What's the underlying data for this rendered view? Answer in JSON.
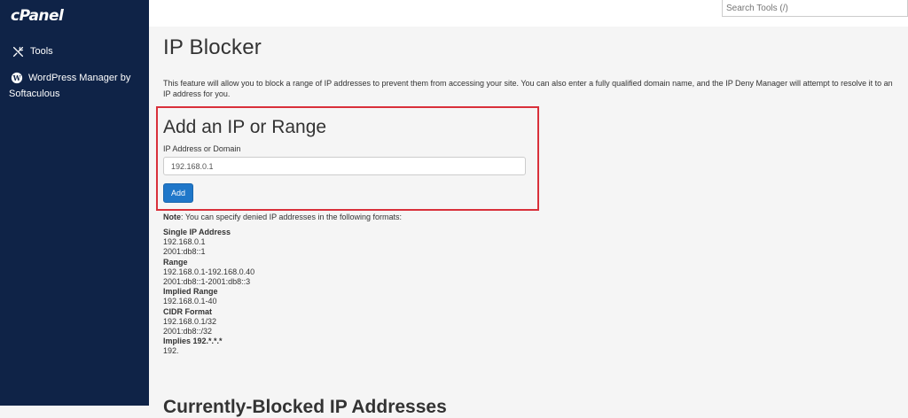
{
  "sidebar": {
    "logo": "cPanel",
    "items": [
      {
        "label": "Tools",
        "icon": "tools-icon"
      },
      {
        "label": "WordPress Manager by Softaculous",
        "icon": "wordpress-icon"
      }
    ]
  },
  "topbar": {
    "search_placeholder": "Search Tools (/)"
  },
  "page": {
    "title": "IP Blocker",
    "intro": "This feature will allow you to block a range of IP addresses to prevent them from accessing your site. You can also enter a fully qualified domain name, and the IP Deny Manager will attempt to resolve it to an IP address for you."
  },
  "add_form": {
    "title": "Add an IP or Range",
    "field_label": "IP Address or Domain",
    "input_value": "192.168.0.1",
    "button_label": "Add"
  },
  "note": {
    "label": "Note",
    "text": ": You can specify denied IP addresses in the following formats:"
  },
  "formats": [
    {
      "heading": "Single IP Address",
      "examples": [
        "192.168.0.1",
        "2001:db8::1"
      ]
    },
    {
      "heading": "Range",
      "examples": [
        "192.168.0.1-192.168.0.40",
        "2001:db8::1-2001:db8::3"
      ]
    },
    {
      "heading": "Implied Range",
      "examples": [
        "192.168.0.1-40"
      ]
    },
    {
      "heading": "CIDR Format",
      "examples": [
        "192.168.0.1/32",
        "2001:db8::/32"
      ]
    },
    {
      "heading": "Implies 192.*.*.*",
      "examples": [
        "192."
      ]
    }
  ],
  "next_section_title": "Currently-Blocked IP Addresses",
  "colors": {
    "sidebar_bg": "#0f2347",
    "primary_button": "#1f77c9",
    "highlight_border": "#d9303a"
  }
}
